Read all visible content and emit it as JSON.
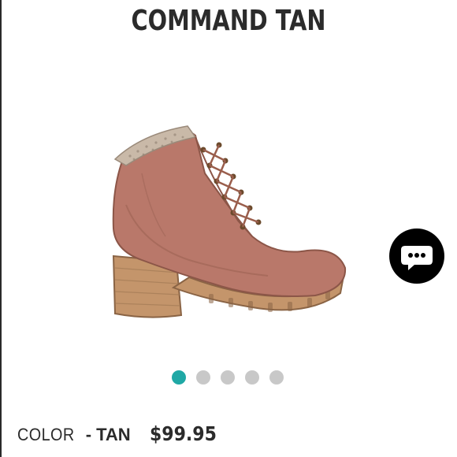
{
  "product": {
    "title": "COMMAND TAN",
    "color_label": "COLOR",
    "color_separator": "-",
    "color_value": "TAN",
    "price": "$99.95"
  },
  "gallery": {
    "image_count": 5,
    "active_index": 0,
    "active_color": "#1fa8a5",
    "inactive_color": "#c8c8c8"
  },
  "chat": {
    "icon": "chat-bubble-icon",
    "background": "#000000"
  },
  "colors": {
    "boot": "#b9786a",
    "heel": "#c4956b",
    "sole": "#c4956b",
    "collar_knit": "#c9b9a8"
  }
}
